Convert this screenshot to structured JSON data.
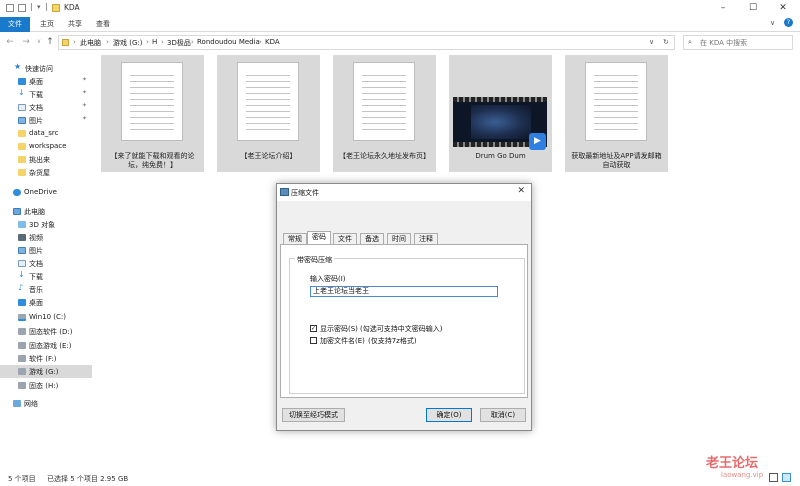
{
  "window": {
    "title": "KDA"
  },
  "ribbon": {
    "tabs": [
      "文件",
      "主页",
      "共享",
      "查看"
    ]
  },
  "address": {
    "crumbs": [
      "此电脑",
      "游戏 (G:)",
      "H",
      "3D极品",
      "Rondoudou Media",
      "KDA"
    ],
    "search_placeholder": "在 KDA 中搜索"
  },
  "sidebar": {
    "quick_access": "快速访问",
    "quick_items": [
      "桌面",
      "下载",
      "文档",
      "图片",
      "data_src",
      "workspace",
      "挑出来",
      "杂货屋"
    ],
    "onedrive": "OneDrive",
    "this_pc": "此电脑",
    "pc_items": [
      "3D 对象",
      "视频",
      "图片",
      "文档",
      "下载",
      "音乐",
      "桌面",
      "Win10 (C:)",
      "固态软件 (D:)",
      "固态游戏 (E:)",
      "软件 (F:)",
      "游戏 (G:)",
      "固态 (H:)"
    ],
    "network": "网络"
  },
  "files": [
    {
      "name": "【来了就能下载和观看的论坛，纯免费！】",
      "type": "document"
    },
    {
      "name": "【老王论坛介绍】",
      "type": "document"
    },
    {
      "name": "【老王论坛永久地址发布页】",
      "type": "document"
    },
    {
      "name": "Drum Go Dum",
      "type": "video"
    },
    {
      "name": "获取最新地址及APP请发邮箱自动获取",
      "type": "document"
    }
  ],
  "status": {
    "count": "5 个项目",
    "selection": "已选择 5 个项目  2.95 GB"
  },
  "dialog": {
    "title": "压缩文件",
    "tabs": [
      "常规",
      "密码",
      "文件",
      "备选",
      "时间",
      "注释"
    ],
    "active_tab": "密码",
    "group_title": "带密码压缩",
    "password_label": "输入密码(I)",
    "password_value": "上老王论坛当老王",
    "show_password_label": "显示密码(S)",
    "show_password_note": "(勾选可支持中文密码输入)",
    "show_password_checked": true,
    "encrypt_names_label": "加密文件名(E)",
    "encrypt_names_note": "(仅支持7z格式)",
    "encrypt_names_checked": false,
    "wizard_button": "切换至经巧模式",
    "ok_button": "确定(O)",
    "cancel_button": "取消(C)"
  },
  "watermark": {
    "line1": "老王论坛",
    "line2": "laowang.vip"
  },
  "colors": {
    "accent": "#1979ca",
    "tile_bg": "#d9d9d9",
    "selection": "#cce8ff",
    "watermark": "#e86b6b"
  }
}
